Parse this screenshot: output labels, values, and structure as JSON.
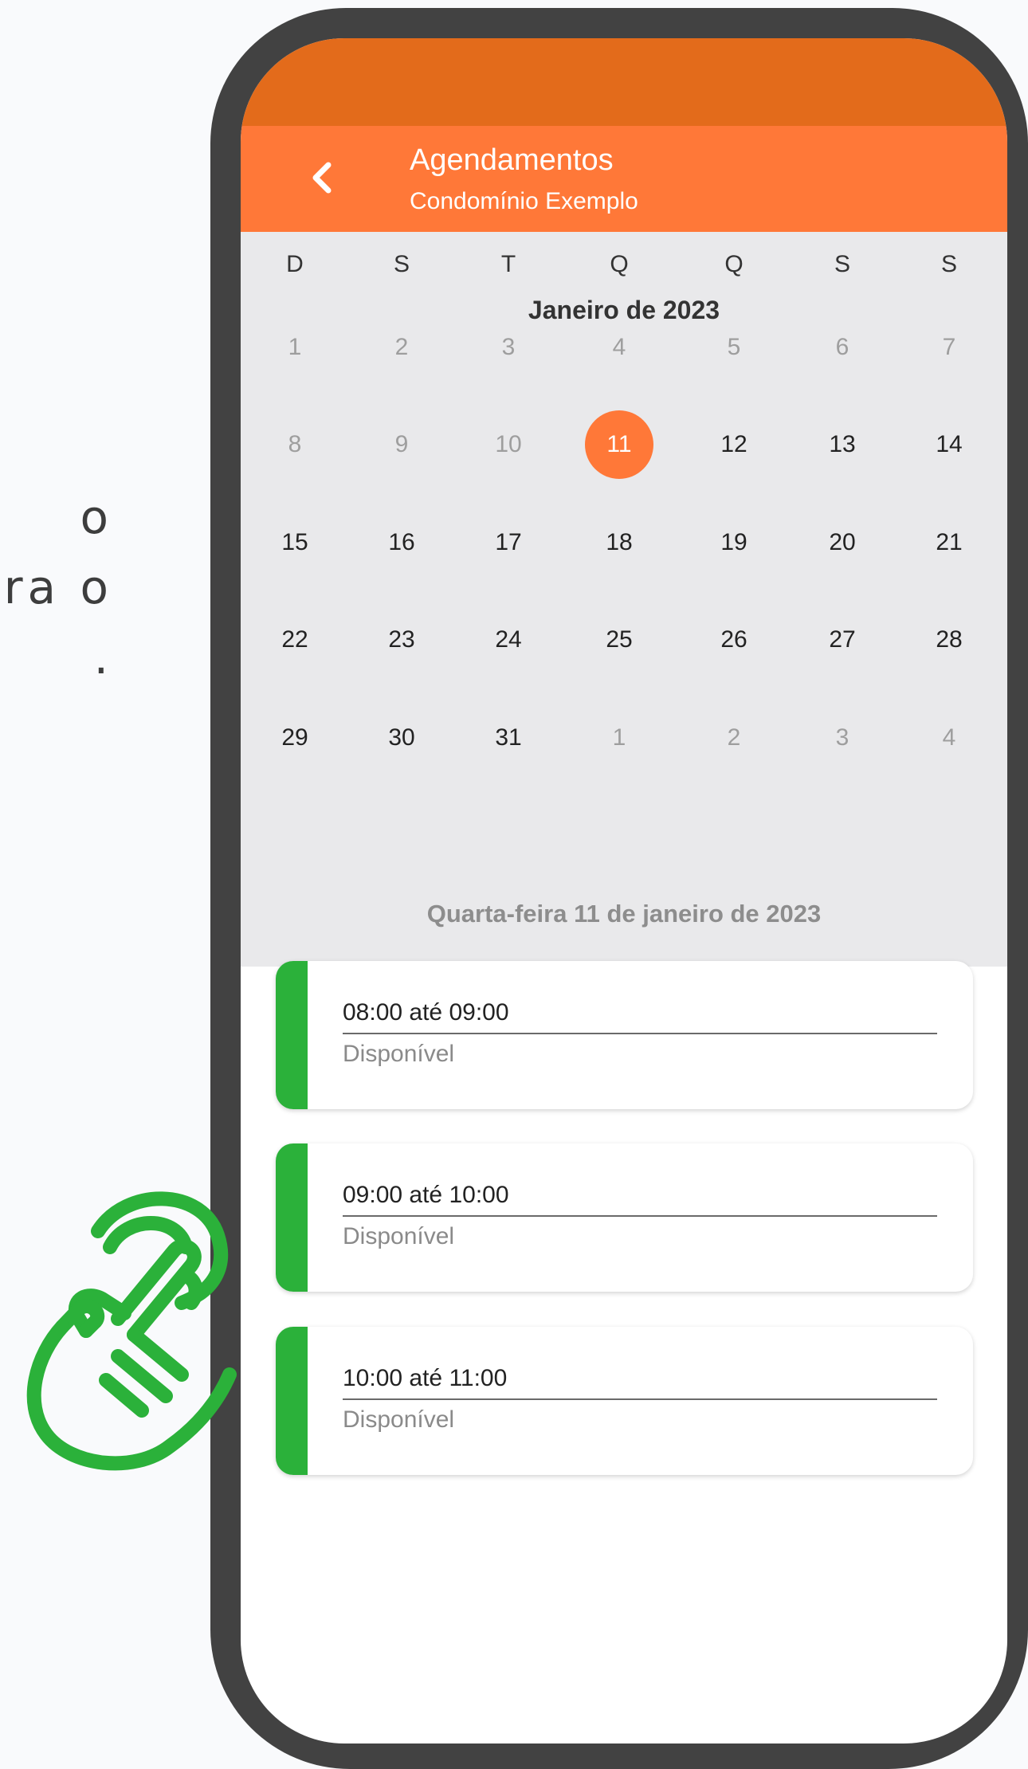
{
  "promo": {
    "lines": [
      "o",
      "ra o",
      "."
    ]
  },
  "appbar": {
    "title": "Agendamentos",
    "subtitle": "Condomínio Exemplo"
  },
  "calendar": {
    "weekdays": [
      "D",
      "S",
      "T",
      "Q",
      "Q",
      "S",
      "S"
    ],
    "month_title": "Janeiro de 2023",
    "weeks": [
      [
        {
          "d": "1",
          "s": "muted"
        },
        {
          "d": "2",
          "s": "muted"
        },
        {
          "d": "3",
          "s": "muted"
        },
        {
          "d": "4",
          "s": "muted"
        },
        {
          "d": "5",
          "s": "muted"
        },
        {
          "d": "6",
          "s": "muted"
        },
        {
          "d": "7",
          "s": "muted"
        }
      ],
      [
        {
          "d": "8",
          "s": "muted"
        },
        {
          "d": "9",
          "s": "muted"
        },
        {
          "d": "10",
          "s": "muted"
        },
        {
          "d": "11",
          "s": "selected"
        },
        {
          "d": "12",
          "s": "normal"
        },
        {
          "d": "13",
          "s": "normal"
        },
        {
          "d": "14",
          "s": "normal"
        }
      ],
      [
        {
          "d": "15",
          "s": "normal"
        },
        {
          "d": "16",
          "s": "normal"
        },
        {
          "d": "17",
          "s": "normal"
        },
        {
          "d": "18",
          "s": "normal"
        },
        {
          "d": "19",
          "s": "normal"
        },
        {
          "d": "20",
          "s": "normal"
        },
        {
          "d": "21",
          "s": "normal"
        }
      ],
      [
        {
          "d": "22",
          "s": "normal"
        },
        {
          "d": "23",
          "s": "normal"
        },
        {
          "d": "24",
          "s": "normal"
        },
        {
          "d": "25",
          "s": "normal"
        },
        {
          "d": "26",
          "s": "normal"
        },
        {
          "d": "27",
          "s": "normal"
        },
        {
          "d": "28",
          "s": "normal"
        }
      ],
      [
        {
          "d": "29",
          "s": "normal"
        },
        {
          "d": "30",
          "s": "normal"
        },
        {
          "d": "31",
          "s": "normal"
        },
        {
          "d": "1",
          "s": "muted"
        },
        {
          "d": "2",
          "s": "muted"
        },
        {
          "d": "3",
          "s": "muted"
        },
        {
          "d": "4",
          "s": "muted"
        }
      ]
    ],
    "selected_date_label": "Quarta-feira 11 de janeiro de 2023"
  },
  "slots": [
    {
      "time": "08:00 até 09:00",
      "status": "Disponível"
    },
    {
      "time": "09:00 até 10:00",
      "status": "Disponível"
    },
    {
      "time": "10:00 até 11:00",
      "status": "Disponível"
    }
  ],
  "colors": {
    "status_bar": "#e36b1b",
    "appbar": "#ff7838",
    "accent": "#ff7838",
    "available": "#2bb13a",
    "phone_frame": "#424242",
    "calendar_bg": "#e9e9eb"
  },
  "icons": {
    "back": "chevron-left-icon",
    "tap_hint": "hand-tap-icon"
  }
}
